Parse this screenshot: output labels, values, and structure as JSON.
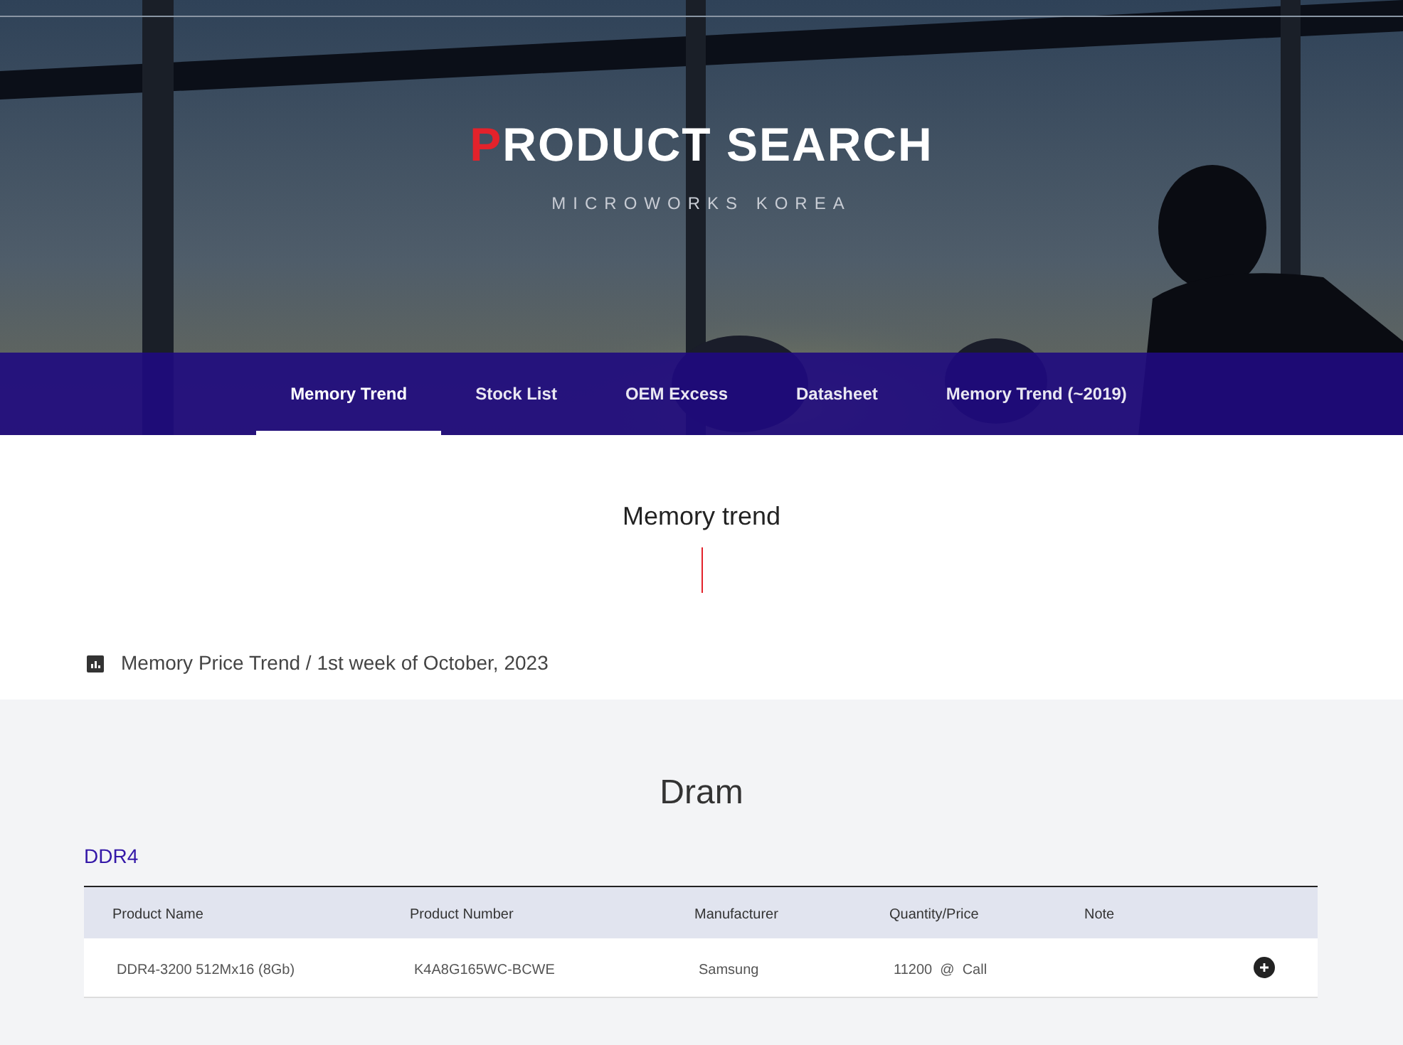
{
  "hero": {
    "title": "PRODUCT SEARCH",
    "subtitle": "MICROWORKS KOREA"
  },
  "tabs": [
    {
      "label": "Memory Trend",
      "selected": true
    },
    {
      "label": "Stock List",
      "selected": false
    },
    {
      "label": "OEM Excess",
      "selected": false
    },
    {
      "label": "Datasheet",
      "selected": false
    },
    {
      "label": "Memory Trend (~2019)",
      "selected": false
    }
  ],
  "section_title": "Memory trend",
  "caption": "Memory Price Trend / 1st week of October, 2023",
  "category_title": "Dram",
  "group_title": "DDR4",
  "table": {
    "columns": [
      "Product Name",
      "Product Number",
      "Manufacturer",
      "Quantity/Price",
      "Note"
    ],
    "rows": [
      {
        "cells": [
          "DDR4-3200 512Mx16 (8Gb)",
          "K4A8G165WC-BCWE",
          "Samsung",
          "11200  @  Call",
          ""
        ]
      }
    ]
  }
}
